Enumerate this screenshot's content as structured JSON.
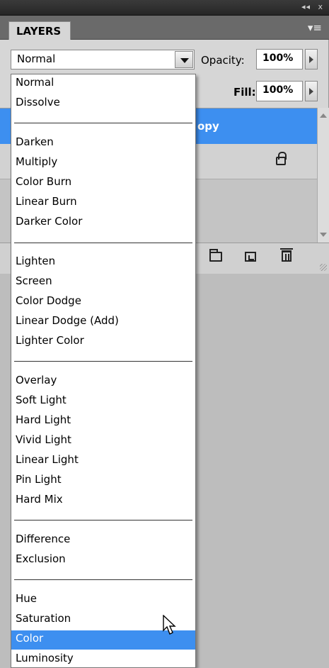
{
  "panel": {
    "tab_label": "LAYERS",
    "titlebar_collapse": "◂◂",
    "titlebar_close": "x",
    "panel_menu_glyph": "▾≡"
  },
  "blend": {
    "current": "Normal",
    "options": [
      "Normal",
      "Dissolve",
      "Darken",
      "Multiply",
      "Color Burn",
      "Linear Burn",
      "Darker Color",
      "Lighten",
      "Screen",
      "Color Dodge",
      "Linear Dodge (Add)",
      "Lighter Color",
      "Overlay",
      "Soft Light",
      "Hard Light",
      "Vivid Light",
      "Linear Light",
      "Pin Light",
      "Hard Mix",
      "Difference",
      "Exclusion",
      "Hue",
      "Saturation",
      "Color",
      "Luminosity"
    ],
    "highlighted": "Color"
  },
  "opacity": {
    "label": "Opacity:",
    "value": "100%"
  },
  "fill": {
    "label": "Fill:",
    "value": "100%"
  },
  "layers": [
    {
      "name": "opy",
      "selected": true
    },
    {
      "name": "",
      "locked": true
    }
  ],
  "colors": {
    "highlight": "#3d8ff0",
    "panel": "#d6d6d6",
    "canvas": "#bdbdbd"
  }
}
